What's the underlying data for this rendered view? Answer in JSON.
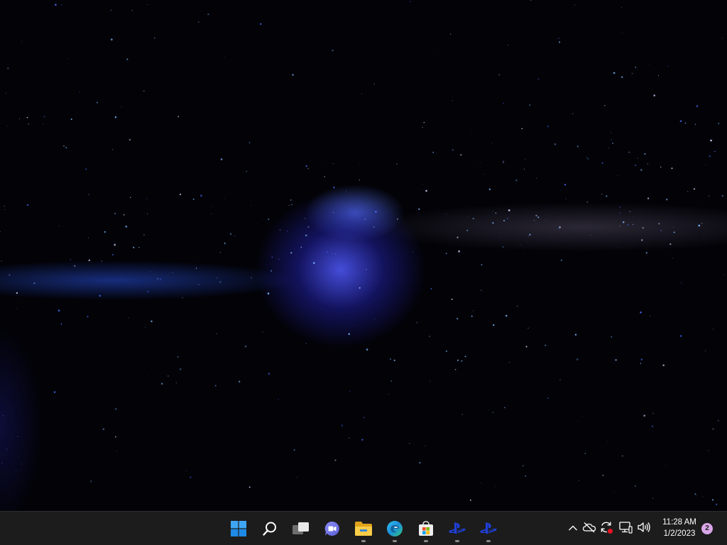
{
  "wallpaper": {
    "description_colors": [
      "#020207",
      "#3c48f0",
      "#2850dc"
    ]
  },
  "taskbar": {
    "background": "#1c1c1c",
    "apps": [
      {
        "name": "start-icon",
        "running": false
      },
      {
        "name": "search-icon",
        "running": false
      },
      {
        "name": "task-view-icon",
        "running": false
      },
      {
        "name": "chat-icon",
        "running": false
      },
      {
        "name": "file-explorer-icon",
        "running": true
      },
      {
        "name": "edge-icon",
        "running": true
      },
      {
        "name": "microsoft-store-icon",
        "running": true
      },
      {
        "name": "playstation-icon",
        "running": true
      },
      {
        "name": "playstation-icon",
        "running": true
      }
    ],
    "tray": {
      "icons": [
        "chevron-up-icon",
        "onedrive-off-icon",
        "sync-error-icon",
        "network-icon",
        "volume-icon"
      ],
      "time": "11:28 AM",
      "date": "1/2/2023",
      "notification_count": "2"
    }
  }
}
